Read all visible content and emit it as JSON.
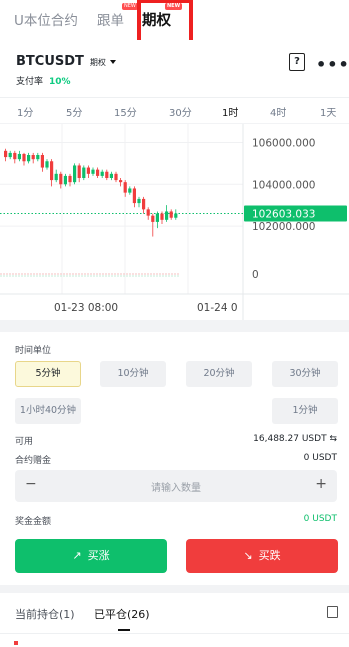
{
  "top_tabs": [
    {
      "label": "U本位合约",
      "active": false
    },
    {
      "label": "跟单",
      "badge": "NEW",
      "active": false
    },
    {
      "label": "期权",
      "badge": "NEW",
      "active": true
    }
  ],
  "symbol": {
    "name": "BTCUSDT",
    "tag": "期权"
  },
  "funding": {
    "label": "支付率",
    "value": "10%"
  },
  "intervals": [
    "1分",
    "5分",
    "15分",
    "30分",
    "1时",
    "4时",
    "1天"
  ],
  "active_interval": "1时",
  "chart_data": {
    "type": "candlestick",
    "price_axis_ticks": [
      "106000.000",
      "104000.000",
      "102000.000"
    ],
    "volume_axis_tick": "0",
    "current_price": "102603.033",
    "time_labels": [
      "01-23 08:00",
      "01-24 0"
    ],
    "candles": [
      {
        "o": 105600,
        "c": 105300,
        "h": 105700,
        "l": 105100
      },
      {
        "o": 105300,
        "c": 105500,
        "h": 105600,
        "l": 105200
      },
      {
        "o": 105500,
        "c": 105200,
        "h": 105600,
        "l": 105000
      },
      {
        "o": 105200,
        "c": 105450,
        "h": 105600,
        "l": 105100
      },
      {
        "o": 105450,
        "c": 105100,
        "h": 105500,
        "l": 104900
      },
      {
        "o": 105100,
        "c": 105400,
        "h": 105500,
        "l": 105000
      },
      {
        "o": 105400,
        "c": 105200,
        "h": 105500,
        "l": 105000
      },
      {
        "o": 105200,
        "c": 105400,
        "h": 105500,
        "l": 105100
      },
      {
        "o": 105400,
        "c": 104800,
        "h": 105500,
        "l": 104600
      },
      {
        "o": 104800,
        "c": 105100,
        "h": 105200,
        "l": 104700
      },
      {
        "o": 105100,
        "c": 104200,
        "h": 105200,
        "l": 103900
      },
      {
        "o": 104200,
        "c": 104500,
        "h": 104700,
        "l": 104100
      },
      {
        "o": 104500,
        "c": 104000,
        "h": 104600,
        "l": 103800
      },
      {
        "o": 104000,
        "c": 104400,
        "h": 104500,
        "l": 103900
      },
      {
        "o": 104400,
        "c": 104100,
        "h": 104500,
        "l": 103900
      },
      {
        "o": 104100,
        "c": 104900,
        "h": 105000,
        "l": 104000
      },
      {
        "o": 104900,
        "c": 104300,
        "h": 105000,
        "l": 104100
      },
      {
        "o": 104300,
        "c": 104800,
        "h": 104900,
        "l": 104200
      },
      {
        "o": 104800,
        "c": 104500,
        "h": 104900,
        "l": 104300
      },
      {
        "o": 104500,
        "c": 104700,
        "h": 104800,
        "l": 104400
      },
      {
        "o": 104700,
        "c": 104400,
        "h": 104800,
        "l": 104300
      },
      {
        "o": 104400,
        "c": 104600,
        "h": 104700,
        "l": 104300
      },
      {
        "o": 104600,
        "c": 104300,
        "h": 104700,
        "l": 104200
      },
      {
        "o": 104300,
        "c": 104500,
        "h": 104600,
        "l": 104200
      },
      {
        "o": 104500,
        "c": 104200,
        "h": 104600,
        "l": 104100
      },
      {
        "o": 104200,
        "c": 104100,
        "h": 104300,
        "l": 103900
      },
      {
        "o": 104100,
        "c": 103600,
        "h": 104200,
        "l": 103400
      },
      {
        "o": 103600,
        "c": 103800,
        "h": 103900,
        "l": 103500
      },
      {
        "o": 103800,
        "c": 103100,
        "h": 103900,
        "l": 102900
      },
      {
        "o": 103100,
        "c": 103300,
        "h": 103400,
        "l": 102900
      },
      {
        "o": 103300,
        "c": 102800,
        "h": 103400,
        "l": 102600
      },
      {
        "o": 102800,
        "c": 102500,
        "h": 102900,
        "l": 102300
      },
      {
        "o": 102500,
        "c": 102200,
        "h": 102600,
        "l": 101500
      },
      {
        "o": 102200,
        "c": 102600,
        "h": 102700,
        "l": 101900
      },
      {
        "o": 102600,
        "c": 102300,
        "h": 102700,
        "l": 102100
      },
      {
        "o": 102300,
        "c": 102700,
        "h": 103000,
        "l": 102200
      },
      {
        "o": 102700,
        "c": 102400,
        "h": 102800,
        "l": 102300
      },
      {
        "o": 102400,
        "c": 102600,
        "h": 102800,
        "l": 102300
      }
    ],
    "ylim": [
      101000,
      106500
    ]
  },
  "time_unit": {
    "label": "时间单位",
    "options": [
      "5分钟",
      "10分钟",
      "20分钟",
      "30分钟",
      "1小时40分钟",
      "1分钟"
    ],
    "selected": "5分钟"
  },
  "balance": {
    "label": "可用",
    "value": "16,488.27 USDT"
  },
  "margin": {
    "label": "合约赠金",
    "value": "0 USDT"
  },
  "quantity": {
    "placeholder": "请输入数量",
    "minus": "−",
    "plus": "+"
  },
  "bonus": {
    "label": "奖金金额",
    "value": "0 USDT"
  },
  "actions": {
    "buy": "买涨",
    "sell": "买跌"
  },
  "bottom_tabs": [
    {
      "label": "当前持仓(1)",
      "active": false
    },
    {
      "label": "已平仓(26)",
      "active": true
    }
  ],
  "colors": {
    "up": "#0ebf6c",
    "down": "#f03d3d",
    "accent": "#f0b90b"
  }
}
